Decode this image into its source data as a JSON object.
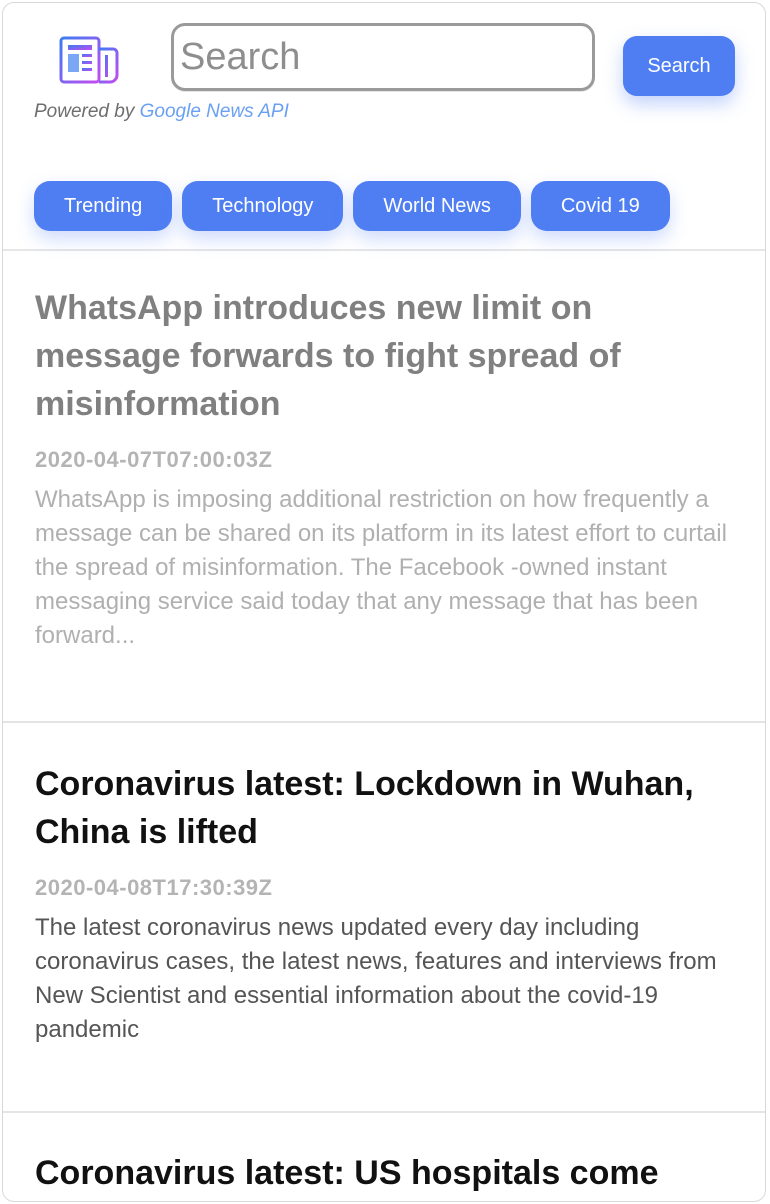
{
  "header": {
    "logo_icon": "newspaper-icon",
    "search": {
      "placeholder": "Search",
      "value": "",
      "button_label": "Search"
    },
    "powered_by": {
      "prefix": "Powered by",
      "link": "Google News API"
    }
  },
  "categories": [
    {
      "label": "Trending"
    },
    {
      "label": "Technology"
    },
    {
      "label": "World News"
    },
    {
      "label": "Covid 19"
    }
  ],
  "articles": [
    {
      "title": "WhatsApp introduces new limit on message forwards to fight spread of misinformation",
      "published": "2020-04-07T07:00:03Z",
      "description": "WhatsApp is imposing additional restriction on how frequently a message can be shared on its platform in its latest effort to curtail the spread of misinformation. The Facebook -owned instant messaging service said today that any message that has been forward..."
    },
    {
      "title": "Coronavirus latest: Lockdown in Wuhan, China is lifted",
      "published": "2020-04-08T17:30:39Z",
      "description": "The latest coronavirus news updated every day including coronavirus cases, the latest news, features and interviews from New Scientist and essential information about the covid-19 pandemic"
    },
    {
      "title": "Coronavirus latest: US hospitals come"
    }
  ],
  "colors": {
    "accent": "#4f7ef3",
    "link": "#6aa0f3",
    "visited_title": "#808080",
    "date": "#b4b4b4"
  }
}
